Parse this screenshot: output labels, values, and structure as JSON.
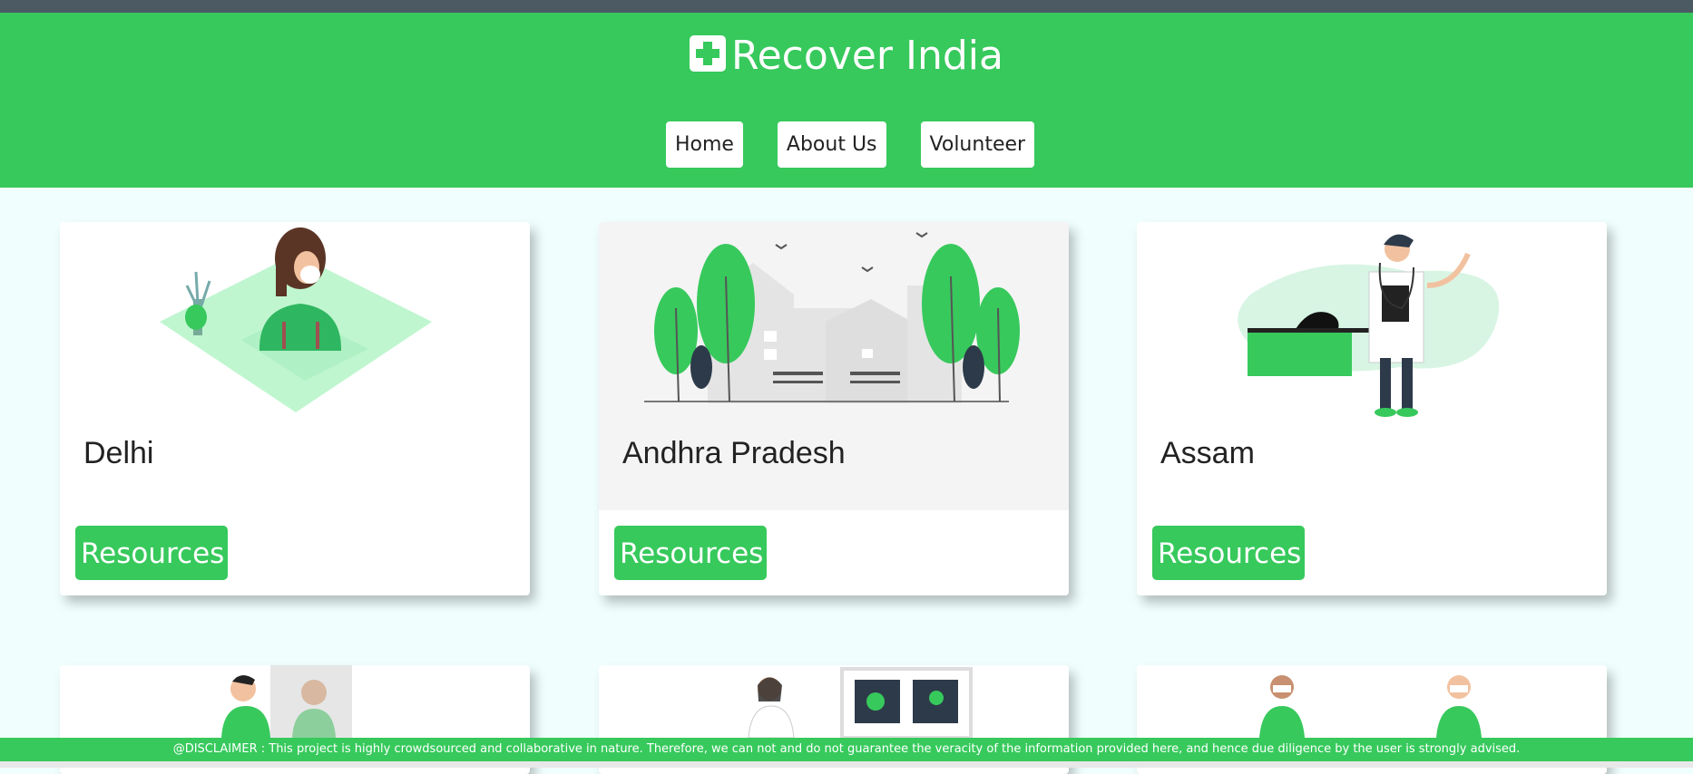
{
  "header": {
    "logo_icon": "hospital-plus-icon",
    "title": "Recover India",
    "nav": [
      {
        "label": "Home"
      },
      {
        "label": "About Us"
      },
      {
        "label": "Volunteer"
      }
    ]
  },
  "cards": [
    {
      "state": "Delhi",
      "button": "Resources"
    },
    {
      "state": "Andhra Pradesh",
      "button": "Resources"
    },
    {
      "state": "Assam",
      "button": "Resources"
    }
  ],
  "disclaimer": "@DISCLAIMER : This project is highly crowdsourced and collaborative in nature. Therefore, we can not and do not guarantee the veracity of the information provided here, and hence due diligence by the user is strongly advised.",
  "colors": {
    "brand_green": "#37c95c",
    "top_bar": "#4b5a63",
    "page_bg": "#f0fffe"
  }
}
